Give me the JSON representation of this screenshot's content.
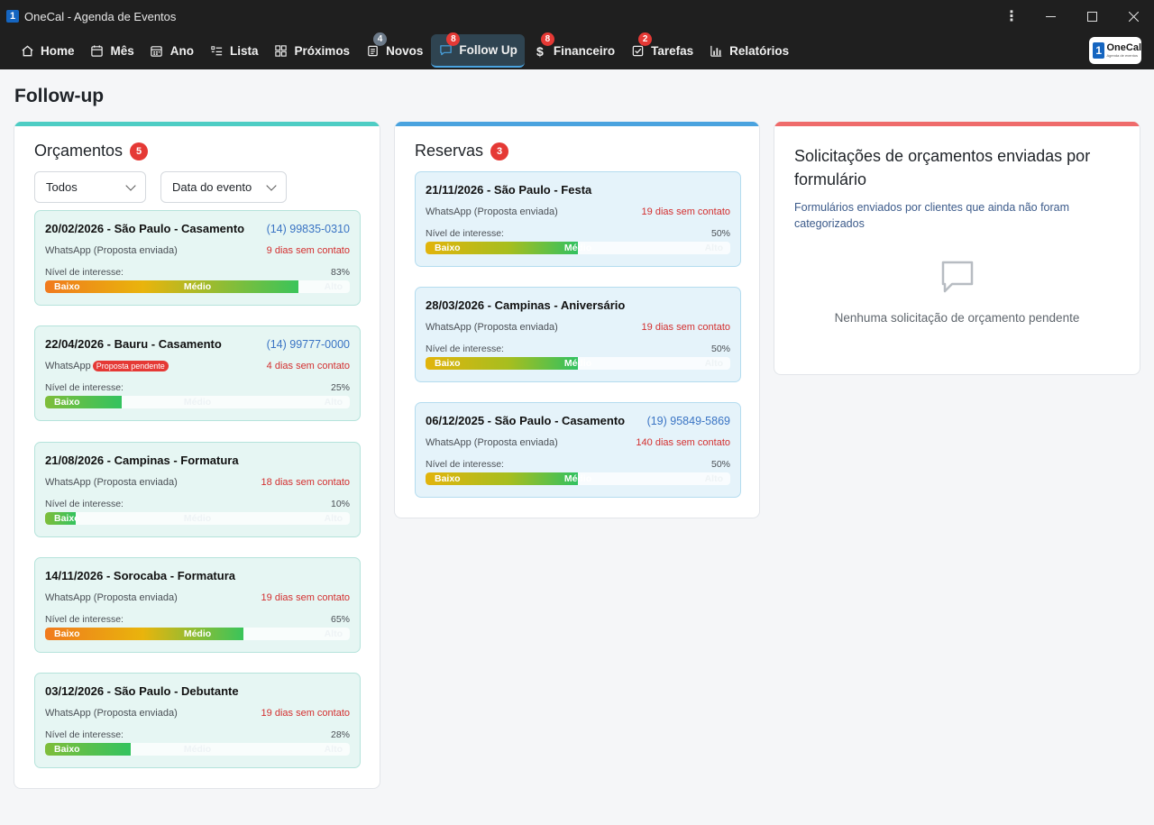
{
  "window": {
    "title": "OneCal - Agenda de Eventos",
    "app_icon": "1"
  },
  "nav": {
    "items": [
      {
        "label": "Home",
        "icon": "home-icon"
      },
      {
        "label": "Mês",
        "icon": "calendar-icon"
      },
      {
        "label": "Ano",
        "icon": "calendar-grid-icon"
      },
      {
        "label": "Lista",
        "icon": "list-icon"
      },
      {
        "label": "Próximos",
        "icon": "grid-icon"
      },
      {
        "label": "Novos",
        "icon": "document-icon",
        "badge": "4"
      },
      {
        "label": "Follow Up",
        "icon": "chat-icon",
        "badge": "8"
      },
      {
        "label": "Financeiro",
        "icon": "dollar-icon",
        "badge": "8"
      },
      {
        "label": "Tarefas",
        "icon": "checkbox-icon",
        "badge": "2"
      },
      {
        "label": "Relatórios",
        "icon": "bar-chart-icon"
      }
    ],
    "active": "Follow Up",
    "brand": {
      "mark": "1",
      "name": "OneCal",
      "tagline": "Agenda de eventos"
    }
  },
  "page": {
    "title": "Follow-up"
  },
  "orcamentos": {
    "title": "Orçamentos",
    "count": "5",
    "accent": "#4ecdc4",
    "filter_status": "Todos",
    "filter_sort": "Data do evento",
    "cards": [
      {
        "title": "20/02/2026 - São Paulo - Casamento",
        "phone": "(14) 99835-0310",
        "channel": "WhatsApp (Proposta enviada)",
        "channel_badge": "",
        "days": "9 dias sem contato",
        "interest_label": "Nível de interesse:",
        "interest": "83%",
        "interest_value": 0.83,
        "low": "Baixo",
        "mid": "Médio",
        "high": "Alto"
      },
      {
        "title": "22/04/2026 - Bauru - Casamento",
        "phone": "(14) 99777-0000",
        "channel": "WhatsApp",
        "channel_badge": "Proposta pendente",
        "days": "4 dias sem contato",
        "interest_label": "Nível de interesse:",
        "interest": "25%",
        "interest_value": 0.25,
        "low": "Baixo",
        "mid": "Médio",
        "high": "Alto"
      },
      {
        "title": "21/08/2026 - Campinas - Formatura",
        "phone": "",
        "channel": "WhatsApp (Proposta enviada)",
        "channel_badge": "",
        "days": "18 dias sem contato",
        "interest_label": "Nível de interesse:",
        "interest": "10%",
        "interest_value": 0.1,
        "low": "Baixo",
        "mid": "Médio",
        "high": "Alto"
      },
      {
        "title": "14/11/2026 - Sorocaba - Formatura",
        "phone": "",
        "channel": "WhatsApp (Proposta enviada)",
        "channel_badge": "",
        "days": "19 dias sem contato",
        "interest_label": "Nível de interesse:",
        "interest": "65%",
        "interest_value": 0.65,
        "low": "Baixo",
        "mid": "Médio",
        "high": "Alto"
      },
      {
        "title": "03/12/2026 - São Paulo - Debutante",
        "phone": "",
        "channel": "WhatsApp (Proposta enviada)",
        "channel_badge": "",
        "days": "19 dias sem contato",
        "interest_label": "Nível de interesse:",
        "interest": "28%",
        "interest_value": 0.28,
        "low": "Baixo",
        "mid": "Médio",
        "high": "Alto"
      }
    ]
  },
  "reservas": {
    "title": "Reservas",
    "count": "3",
    "accent": "#4aa3df",
    "cards": [
      {
        "title": "21/11/2026 - São Paulo - Festa",
        "phone": "",
        "channel": "WhatsApp (Proposta enviada)",
        "channel_badge": "",
        "days": "19 dias sem contato",
        "interest_label": "Nível de interesse:",
        "interest": "50%",
        "interest_value": 0.5,
        "low": "Baixo",
        "mid": "Médio",
        "high": "Alto"
      },
      {
        "title": "28/03/2026 - Campinas - Aniversário",
        "phone": "",
        "channel": "WhatsApp (Proposta enviada)",
        "channel_badge": "",
        "days": "19 dias sem contato",
        "interest_label": "Nível de interesse:",
        "interest": "50%",
        "interest_value": 0.5,
        "low": "Baixo",
        "mid": "Médio",
        "high": "Alto"
      },
      {
        "title": "06/12/2025 - São Paulo - Casamento",
        "phone": "(19) 95849-5869",
        "channel": "WhatsApp (Proposta enviada)",
        "channel_badge": "",
        "days": "140 dias sem contato",
        "interest_label": "Nível de interesse:",
        "interest": "50%",
        "interest_value": 0.5,
        "low": "Baixo",
        "mid": "Médio",
        "high": "Alto"
      }
    ]
  },
  "solicitacoes": {
    "title": "Solicitações de orçamentos enviadas por formulário",
    "subtitle": "Formulários enviados por clientes que ainda não foram categorizados",
    "accent": "#ef6b6b",
    "empty_icon": "chat-bubble-icon",
    "empty_text": "Nenhuma solicitação de orçamento pendente"
  }
}
